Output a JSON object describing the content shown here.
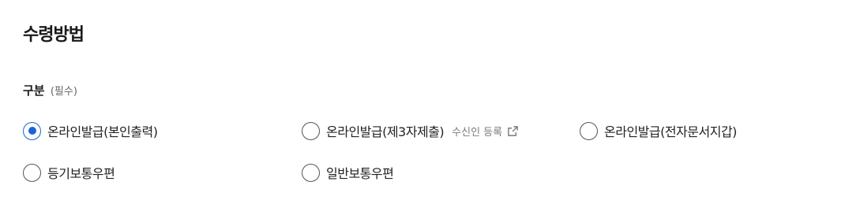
{
  "section": {
    "title": "수령방법"
  },
  "field": {
    "label": "구분",
    "required_text": "(필수)"
  },
  "accent_color": "#1e63d6",
  "options": [
    {
      "label": "온라인발급(본인출력)",
      "checked": true
    },
    {
      "label": "온라인발급(제3자제출)",
      "checked": false,
      "link_text": "수신인 등록",
      "link_icon": "external-link-icon"
    },
    {
      "label": "온라인발급(전자문서지갑)",
      "checked": false
    },
    {
      "label": "등기보통우편",
      "checked": false
    },
    {
      "label": "일반보통우편",
      "checked": false
    }
  ]
}
